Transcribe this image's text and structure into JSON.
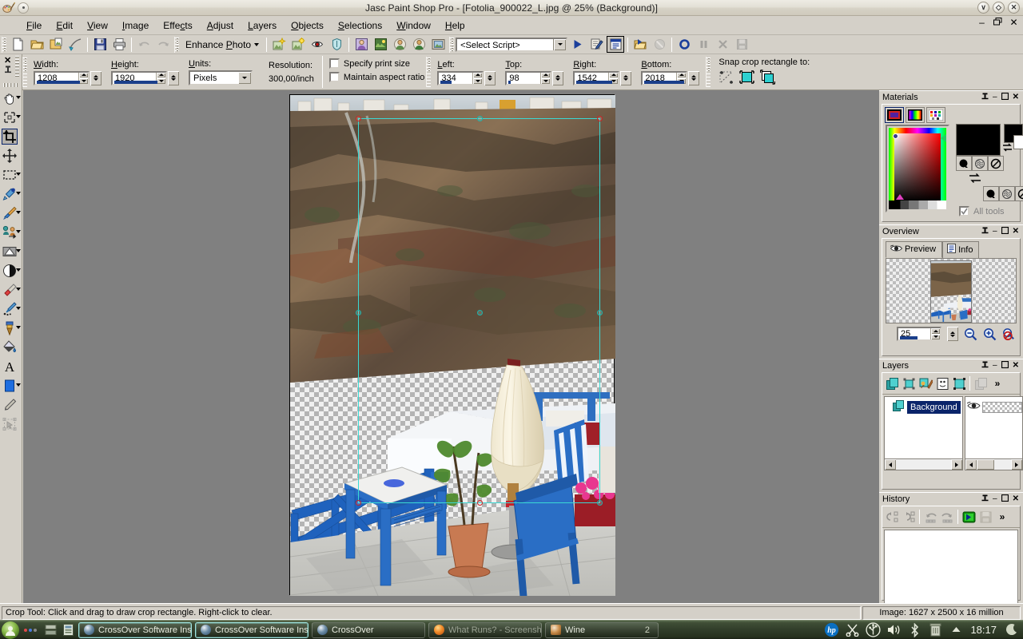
{
  "window": {
    "title": "Jasc Paint Shop Pro - [Fotolia_900022_L.jpg @  25% (Background)]",
    "buttons": {
      "minimize": "∨",
      "restore": "◇",
      "close": "✕"
    },
    "mdi_buttons": {
      "minimize": "–",
      "restore": "❐",
      "close": "✕"
    }
  },
  "menubar": {
    "items": [
      {
        "label": "File",
        "accel": "F"
      },
      {
        "label": "Edit",
        "accel": "E"
      },
      {
        "label": "View",
        "accel": "V"
      },
      {
        "label": "Image",
        "accel": "I"
      },
      {
        "label": "Effects",
        "accel": "c"
      },
      {
        "label": "Adjust",
        "accel": "A"
      },
      {
        "label": "Layers",
        "accel": "L"
      },
      {
        "label": "Objects",
        "accel": "O"
      },
      {
        "label": "Selections",
        "accel": "S"
      },
      {
        "label": "Window",
        "accel": "W"
      },
      {
        "label": "Help",
        "accel": "H"
      }
    ]
  },
  "toolbar_main": {
    "buttons": [
      {
        "name": "new-icon",
        "label": "New"
      },
      {
        "name": "open-icon",
        "label": "Open"
      },
      {
        "name": "browse-icon",
        "label": "Browse"
      },
      {
        "name": "twain-acquire-icon",
        "label": "Acquire"
      },
      {
        "name": "save-icon",
        "label": "Save"
      },
      {
        "name": "print-icon",
        "label": "Print"
      },
      {
        "name": "undo-icon",
        "label": "Undo"
      },
      {
        "name": "redo-icon",
        "label": "Redo"
      },
      {
        "name": "one-step-photo-fix-icon",
        "label": "One Step Photo Fix"
      },
      {
        "name": "smart-photo-fix-icon",
        "label": "Smart Photo Fix"
      },
      {
        "name": "red-eye-removal-icon",
        "label": "Red Eye Removal"
      },
      {
        "name": "makeover-icon",
        "label": "Makeover"
      },
      {
        "name": "full-screen-preview-icon",
        "label": "Full Screen Preview"
      },
      {
        "name": "full-screen-edit-icon",
        "label": "Full Screen Edit"
      },
      {
        "name": "organizer-icon",
        "label": "Organizer"
      },
      {
        "name": "gallery-icon",
        "label": "Gallery"
      },
      {
        "name": "picture-frame-icon",
        "label": "Picture Frame"
      }
    ],
    "enhance_photo": {
      "label": "Enhance Photo",
      "accel": "P"
    },
    "script": {
      "selected": "<Select Script>",
      "buttons": [
        {
          "name": "run-script-icon",
          "label": "Run Selected Script"
        },
        {
          "name": "edit-script-icon",
          "label": "Edit Selected Script"
        },
        {
          "name": "toggle-execution-mode-icon",
          "label": "Toggle Execution Mode"
        },
        {
          "name": "run-script-file-icon",
          "label": "Run Script"
        },
        {
          "name": "stop-script-icon",
          "label": "Stop Script"
        },
        {
          "name": "record-script-icon",
          "label": "Start Script Recording"
        },
        {
          "name": "pause-script-icon",
          "label": "Pause Script Recording"
        },
        {
          "name": "cancel-script-icon",
          "label": "Cancel Script Recording"
        },
        {
          "name": "save-script-icon",
          "label": "Save Script Recording"
        }
      ]
    }
  },
  "crop_options": {
    "width": {
      "label": "Width:",
      "accel": "W",
      "value": "1208"
    },
    "height": {
      "label": "Height:",
      "accel": "H",
      "value": "1920"
    },
    "units": {
      "label": "Units:",
      "accel": "U",
      "value": "Pixels"
    },
    "resolution": {
      "label": "Resolution:",
      "value": "300,00/inch"
    },
    "specify_print_size": {
      "label": "Specify print size",
      "checked": false
    },
    "maintain_aspect_ratio": {
      "label": "Maintain aspect ratio",
      "checked": false
    },
    "left": {
      "label": "Left:",
      "accel": "L",
      "value": "334"
    },
    "top": {
      "label": "Top:",
      "accel": "T",
      "value": "98"
    },
    "right": {
      "label": "Right:",
      "accel": "R",
      "value": "1542"
    },
    "bottom": {
      "label": "Bottom:",
      "accel": "B",
      "value": "2018"
    },
    "snap": {
      "label": "Snap crop rectangle to:",
      "buttons": [
        {
          "name": "snap-to-selection-icon",
          "label": "Current selection"
        },
        {
          "name": "snap-to-layer-opaque-icon",
          "label": "Layer opaque"
        },
        {
          "name": "snap-to-merged-opaque-icon",
          "label": "Merged opaque"
        }
      ]
    }
  },
  "tools": {
    "close_label": "✕",
    "pin_label": "⟐",
    "items": [
      {
        "name": "pan-tool",
        "label": "Pan",
        "flyout": true,
        "active": false
      },
      {
        "name": "zoom-tool",
        "label": "Zoom",
        "flyout": true,
        "active": false
      },
      {
        "name": "crop-tool",
        "label": "Crop",
        "flyout": false,
        "active": true
      },
      {
        "name": "move-tool",
        "label": "Move",
        "flyout": false,
        "active": false
      },
      {
        "name": "selection-tool",
        "label": "Selection",
        "flyout": true,
        "active": false
      },
      {
        "name": "dropper-tool",
        "label": "Dropper",
        "flyout": true,
        "active": false
      },
      {
        "name": "paint-brush-tool",
        "label": "Paint Brush",
        "flyout": true,
        "active": false
      },
      {
        "name": "clone-brush-tool",
        "label": "Clone Brush",
        "flyout": true,
        "active": false
      },
      {
        "name": "dodge-tool",
        "label": "Dodge",
        "flyout": true,
        "active": false
      },
      {
        "name": "burn-tool",
        "label": "Burn",
        "flyout": true,
        "active": false
      },
      {
        "name": "eraser-tool",
        "label": "Eraser",
        "flyout": true,
        "active": false
      },
      {
        "name": "picture-tube-tool",
        "label": "Picture Tube",
        "flyout": true,
        "active": false
      },
      {
        "name": "airbrush-tool",
        "label": "Airbrush",
        "flyout": true,
        "active": false
      },
      {
        "name": "flood-fill-tool",
        "label": "Flood Fill",
        "flyout": false,
        "active": false
      },
      {
        "name": "text-tool",
        "label": "Text",
        "flyout": false,
        "active": false
      },
      {
        "name": "preset-shape-tool",
        "label": "Preset Shape",
        "flyout": true,
        "active": false
      },
      {
        "name": "pen-tool",
        "label": "Pen",
        "flyout": false,
        "active": false
      },
      {
        "name": "object-selection-tool",
        "label": "Object Selection",
        "flyout": false,
        "active": false,
        "disabled": true
      }
    ]
  },
  "materials": {
    "title": "Materials",
    "ctrls": {
      "pin": "⟐",
      "minimize": "–",
      "maximize": "❐",
      "close": "✕"
    },
    "tabs": [
      {
        "name": "frame-tab",
        "label": "Frame"
      },
      {
        "name": "rainbow-tab",
        "label": "Rainbow"
      },
      {
        "name": "swatches-tab",
        "label": "Swatches"
      }
    ],
    "foreground_color": "#000000",
    "background_color": "#ffffff",
    "all_tools": {
      "label": "All tools",
      "checked": true
    }
  },
  "overview": {
    "title": "Overview",
    "ctrls": {
      "pin": "⟐",
      "minimize": "–",
      "maximize": "❐",
      "close": "✕"
    },
    "tabs": [
      {
        "name": "tab-preview",
        "label": "Preview",
        "selected": true
      },
      {
        "name": "tab-info",
        "label": "Info",
        "selected": false
      }
    ],
    "zoom_value": "25",
    "buttons": [
      {
        "name": "zoom-out-icon",
        "label": "Zoom Out"
      },
      {
        "name": "zoom-in-icon",
        "label": "Zoom In"
      },
      {
        "name": "toggle-preview-icon",
        "label": "Toggle Preview"
      }
    ]
  },
  "layers": {
    "title": "Layers",
    "ctrls": {
      "pin": "⟐",
      "minimize": "–",
      "maximize": "❐",
      "close": "✕"
    },
    "toolbar": [
      {
        "name": "new-raster-layer-icon",
        "label": "New Raster Layer"
      },
      {
        "name": "new-vector-layer-icon",
        "label": "New Vector Layer"
      },
      {
        "name": "new-art-media-layer-icon",
        "label": "New Art Media Layer"
      },
      {
        "name": "new-mask-layer-icon",
        "label": "New Mask Layer"
      },
      {
        "name": "new-layer-group-icon",
        "label": "New Layer Group"
      },
      {
        "name": "duplicate-layer-icon",
        "label": "Duplicate Layer"
      },
      {
        "name": "more-layers-icon",
        "label": "»"
      }
    ],
    "rows": [
      {
        "name": "Background",
        "visible": true,
        "selected": true
      }
    ]
  },
  "history": {
    "title": "History",
    "ctrls": {
      "pin": "⟐",
      "minimize": "–",
      "maximize": "❐",
      "close": "✕"
    },
    "toolbar": [
      {
        "name": "undo-to-here-icon",
        "label": "Undo to here"
      },
      {
        "name": "redo-to-here-icon",
        "label": "Redo to here"
      },
      {
        "name": "undo-selected-icon",
        "label": "Undo selected"
      },
      {
        "name": "redo-selected-icon",
        "label": "Redo selected"
      },
      {
        "name": "play-quickscript-icon",
        "label": "Run Selected Actions"
      },
      {
        "name": "save-quickscript-icon",
        "label": "Save QuickScript"
      },
      {
        "name": "more-history-icon",
        "label": "»"
      }
    ],
    "entries": []
  },
  "statusbar": {
    "message": "Crop Tool: Click and drag to draw crop rectangle. Right-click to clear.",
    "image_info": "Image:  1627 x 2500 x 16 million"
  },
  "canvas": {
    "zoom_percent": "25",
    "crop_rect": {
      "left": "334",
      "top": "98",
      "right": "1542",
      "bottom": "2018"
    }
  },
  "taskbar": {
    "launchers": [
      {
        "name": "show-desktop-icon",
        "label": "Show Desktop"
      },
      {
        "name": "workspace-switcher-icon",
        "label": "Workspaces"
      },
      {
        "name": "file-manager-icon",
        "label": "Files"
      }
    ],
    "tasks": [
      {
        "name": "task-crossover-installer-1",
        "label": "CrossOver Software Ins",
        "selected": true,
        "dim": false
      },
      {
        "name": "task-crossover-installer-2",
        "label": "CrossOver Software Ins",
        "selected": true,
        "dim": false
      },
      {
        "name": "task-crossover",
        "label": "CrossOver",
        "selected": false,
        "dim": false
      },
      {
        "name": "task-firefox",
        "label": "What Runs? - Screensh",
        "selected": false,
        "dim": true
      },
      {
        "name": "task-wine",
        "label": "Wine",
        "selected": false,
        "dim": false,
        "count": "2"
      }
    ],
    "tray": [
      {
        "name": "hp-icon",
        "label": "HP"
      },
      {
        "name": "scissors-icon",
        "label": "Screenshot"
      },
      {
        "name": "usb-icon",
        "label": "USB"
      },
      {
        "name": "volume-icon",
        "label": "Volume"
      },
      {
        "name": "bluetooth-icon",
        "label": "Bluetooth"
      },
      {
        "name": "trash-icon",
        "label": "Trash"
      },
      {
        "name": "tray-expand-icon",
        "label": "Show hidden"
      }
    ],
    "clock": "18:17",
    "session_icon": "session-indicator-icon"
  }
}
